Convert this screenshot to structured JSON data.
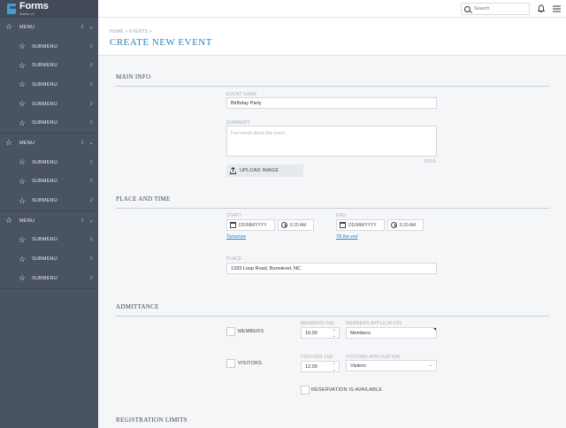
{
  "app": {
    "logo_title": "Forms",
    "logo_sub": "Admin v2"
  },
  "sidebar": {
    "groups": [
      {
        "label": "MENU",
        "count": "2",
        "subitems": [
          {
            "label": "SUBMENU",
            "count": "2"
          },
          {
            "label": "SUBMENU",
            "count": "2"
          },
          {
            "label": "SUBMENU",
            "count": "2"
          },
          {
            "label": "SUBMENU",
            "count": "2"
          },
          {
            "label": "SUBMENU",
            "count": "2"
          }
        ]
      },
      {
        "label": "MENU",
        "count": "2",
        "subitems": [
          {
            "label": "SUBMENU",
            "count": "2"
          },
          {
            "label": "SUBMENU",
            "count": "2"
          },
          {
            "label": "SUBMENU",
            "count": "2"
          }
        ]
      },
      {
        "label": "MENU",
        "count": "2",
        "subitems": [
          {
            "label": "SUBMENU",
            "count": "2"
          },
          {
            "label": "SUBMENU",
            "count": "2"
          },
          {
            "label": "SUBMENU",
            "count": "2"
          }
        ]
      }
    ]
  },
  "header": {
    "search_placeholder": "Search"
  },
  "page": {
    "breadcrumb": "HOME > EVENTS >",
    "title": "CREATE NEW EVENT"
  },
  "main_info": {
    "heading": "MAIN INFO",
    "event_name_label": "EVENT NAME",
    "event_name_value": "Birthday Party",
    "summary_label": "SUMMARY",
    "summary_placeholder": "Few words about this event",
    "summary_counter": "0/250",
    "upload_label": "UPLOAD IMAGE"
  },
  "place_time": {
    "heading": "PLACE AND TIME",
    "start_label": "START",
    "start_date": "DD/MM/YYYY",
    "start_time": "6:20 AM",
    "start_link": "Tomorrow",
    "end_label": "END",
    "end_date": "DD/MM/YYYY",
    "end_time": "6:20 AM",
    "end_link": "Till the end",
    "place_label": "PLACE",
    "place_value": "1333 Loop Road, Bunnlevel, NC"
  },
  "admittance": {
    "heading": "ADMITTANCE",
    "members_label": "MEMBERS",
    "members_fee_label": "MEMBERS FEE",
    "members_fee_value": "10.00",
    "members_app_label": "MEMBERS APPLICATION",
    "members_app_value": "Members",
    "visitors_label": "VISITORS",
    "visitors_fee_label": "VISITORS FEE",
    "visitors_fee_value": "12.00",
    "visitors_app_label": "VISITORS APPLICATION",
    "visitors_app_value": "Visitors",
    "reservation_label": "RESERVATION IS AVAILABLE"
  },
  "registration": {
    "heading": "REGISTRATION LIMITS"
  },
  "colors": {
    "sidebar_bg": "#4a5361",
    "accent": "#2b86c5",
    "logo_mark": "#3da0d8"
  },
  "icons": {
    "menu": "star-icon",
    "search": "search-icon",
    "bell": "bell-icon",
    "burger": "hamburger-icon",
    "upload": "upload-icon",
    "calendar": "calendar-icon",
    "clock": "clock-icon"
  }
}
